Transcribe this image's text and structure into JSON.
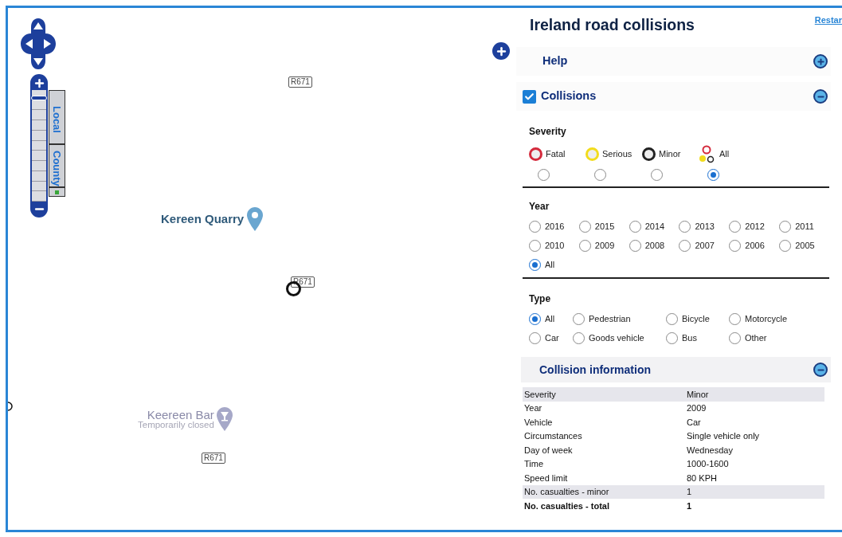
{
  "map": {
    "zoom": {
      "level": 0.95
    },
    "road_labels": [
      "R671",
      "R671",
      "R671"
    ],
    "places": [
      {
        "kind": "quarry",
        "name": "Kereen Quarry"
      },
      {
        "kind": "bar",
        "name": "Keereen Bar",
        "note": "Temporarily closed"
      }
    ],
    "layer_buttons": [
      "Local",
      "County"
    ]
  },
  "sidebar": {
    "title": "Ireland road collisions",
    "restart_link": "Restar",
    "help": {
      "title": "Help",
      "expanded": false
    },
    "collisions": {
      "title": "Collisions",
      "checked": true,
      "expanded": true,
      "severity": {
        "label": "Severity",
        "options": [
          {
            "label": "Fatal",
            "kind": "ring",
            "color": "#d42a3c",
            "selected": false
          },
          {
            "label": "Serious",
            "kind": "ring",
            "color": "#f2dc1c",
            "selected": false
          },
          {
            "label": "Minor",
            "kind": "ring",
            "color": "#222222",
            "selected": false
          },
          {
            "label": "All",
            "kind": "cluster",
            "selected": true
          }
        ]
      },
      "year": {
        "label": "Year",
        "options": [
          {
            "label": "2016",
            "selected": false
          },
          {
            "label": "2015",
            "selected": false
          },
          {
            "label": "2014",
            "selected": false
          },
          {
            "label": "2013",
            "selected": false
          },
          {
            "label": "2012",
            "selected": false
          },
          {
            "label": "2011",
            "selected": false
          },
          {
            "label": "2010",
            "selected": false
          },
          {
            "label": "2009",
            "selected": false
          },
          {
            "label": "2008",
            "selected": false
          },
          {
            "label": "2007",
            "selected": false
          },
          {
            "label": "2006",
            "selected": false
          },
          {
            "label": "2005",
            "selected": false
          },
          {
            "label": "All",
            "selected": true
          }
        ]
      },
      "type": {
        "label": "Type",
        "options": [
          {
            "label": "All",
            "selected": true
          },
          {
            "label": "Pedestrian",
            "selected": false
          },
          {
            "label": "Bicycle",
            "selected": false
          },
          {
            "label": "Motorcycle",
            "selected": false
          },
          {
            "label": "Car",
            "selected": false
          },
          {
            "label": "Goods vehicle",
            "selected": false
          },
          {
            "label": "Bus",
            "selected": false
          },
          {
            "label": "Other",
            "selected": false
          }
        ]
      }
    },
    "info": {
      "title": "Collision information",
      "expanded": true,
      "rows": [
        {
          "label": "Severity",
          "value": "Minor",
          "shaded": true,
          "bold": false
        },
        {
          "label": "Year",
          "value": "2009",
          "shaded": false,
          "bold": false
        },
        {
          "label": "Vehicle",
          "value": "Car",
          "shaded": false,
          "bold": false
        },
        {
          "label": "Circumstances",
          "value": "Single vehicle only",
          "shaded": false,
          "bold": false
        },
        {
          "label": "Day of week",
          "value": "Wednesday",
          "shaded": false,
          "bold": false
        },
        {
          "label": "Time",
          "value": "1000-1600",
          "shaded": false,
          "bold": false
        },
        {
          "label": "Speed limit",
          "value": "80 KPH",
          "shaded": false,
          "bold": false
        },
        {
          "label": "No. casualties - minor",
          "value": "1",
          "shaded": true,
          "bold": false
        },
        {
          "label": "No. casualties - total",
          "value": "1",
          "shaded": false,
          "bold": true
        }
      ]
    }
  }
}
